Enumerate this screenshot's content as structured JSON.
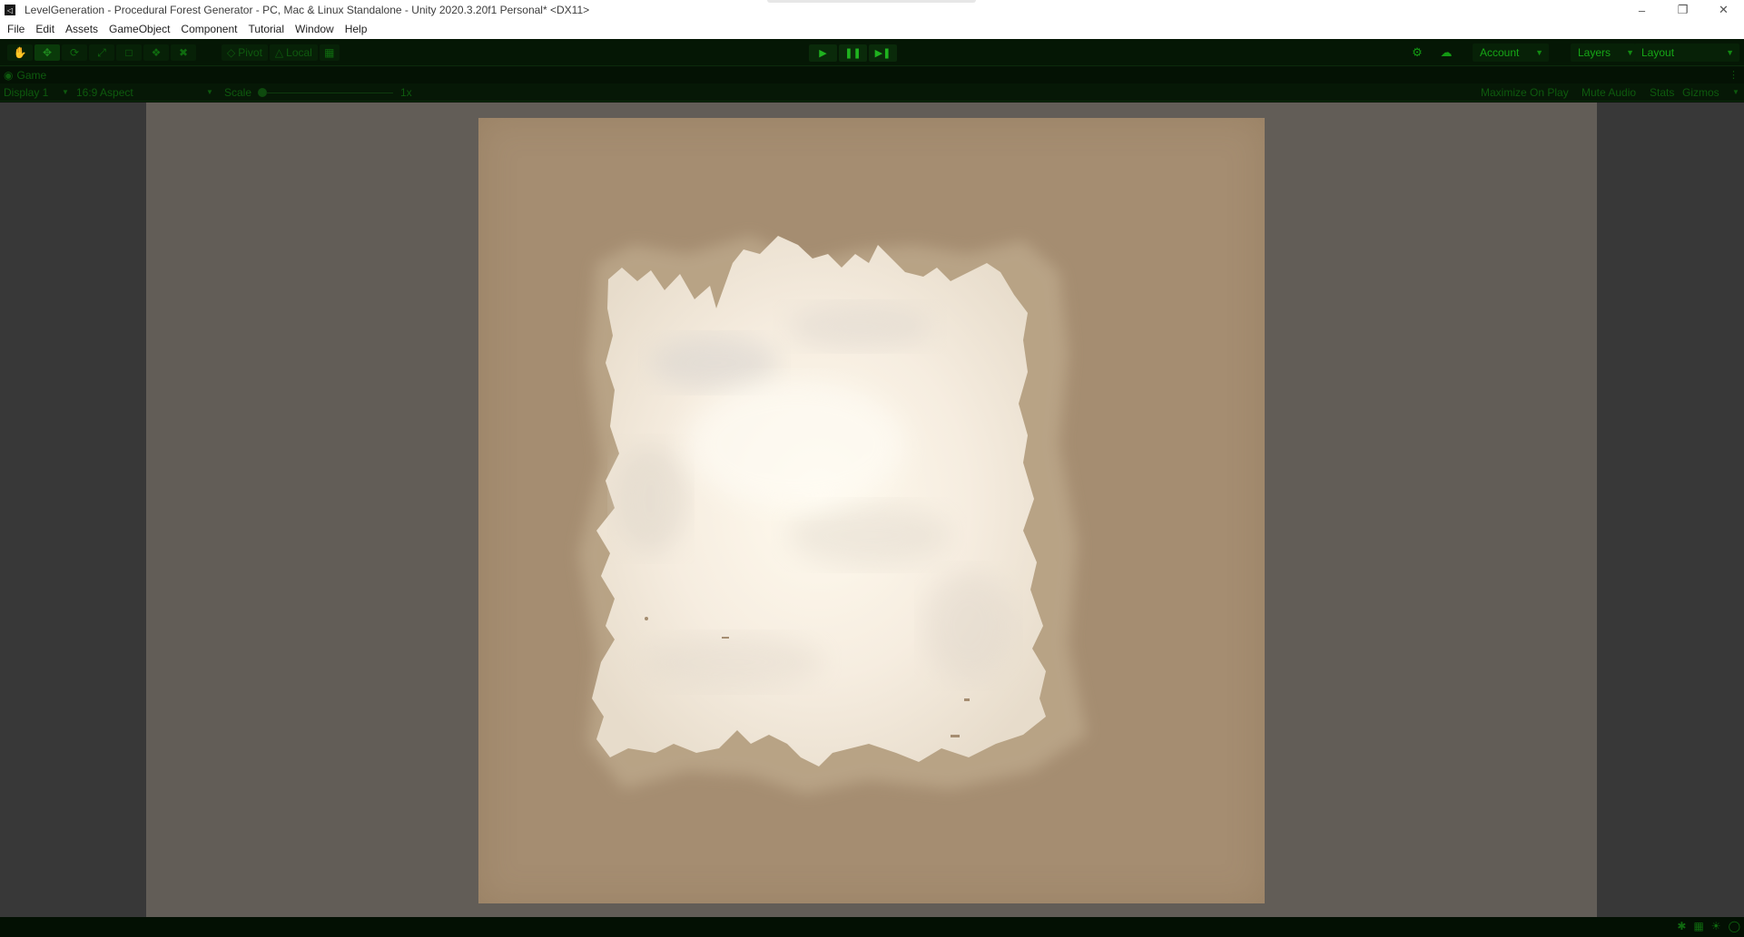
{
  "window": {
    "title": "LevelGeneration - Procedural Forest Generator - PC, Mac & Linux Standalone - Unity 2020.3.20f1 Personal* <DX11>",
    "minimize_icon": "minimize-icon",
    "restore_icon": "restore-icon",
    "close_icon": "close-icon"
  },
  "menu": {
    "items": [
      "File",
      "Edit",
      "Assets",
      "GameObject",
      "Component",
      "Tutorial",
      "Window",
      "Help"
    ]
  },
  "toolbar": {
    "tools": [
      "hand-tool",
      "move-tool",
      "rotate-tool",
      "scale-tool",
      "rect-tool",
      "transform-tool",
      "custom-tool"
    ],
    "pivot_label": "Pivot",
    "local_label": "Local",
    "account_label": "Account",
    "layers_label": "Layers",
    "layout_label": "Layout"
  },
  "game_view": {
    "tab_label": "Game",
    "display_label": "Display 1",
    "aspect_label": "16:9 Aspect",
    "scale_label": "Scale",
    "scale_value": "1x",
    "maximize_label": "Maximize On Play",
    "mute_label": "Mute Audio",
    "stats_label": "Stats",
    "gizmos_label": "Gizmos"
  },
  "colors": {
    "accent": "#16a616",
    "terrain_ground": "#a58d71",
    "terrain_snow": "#f7f0e2",
    "canvas_bg": "#625d57"
  }
}
